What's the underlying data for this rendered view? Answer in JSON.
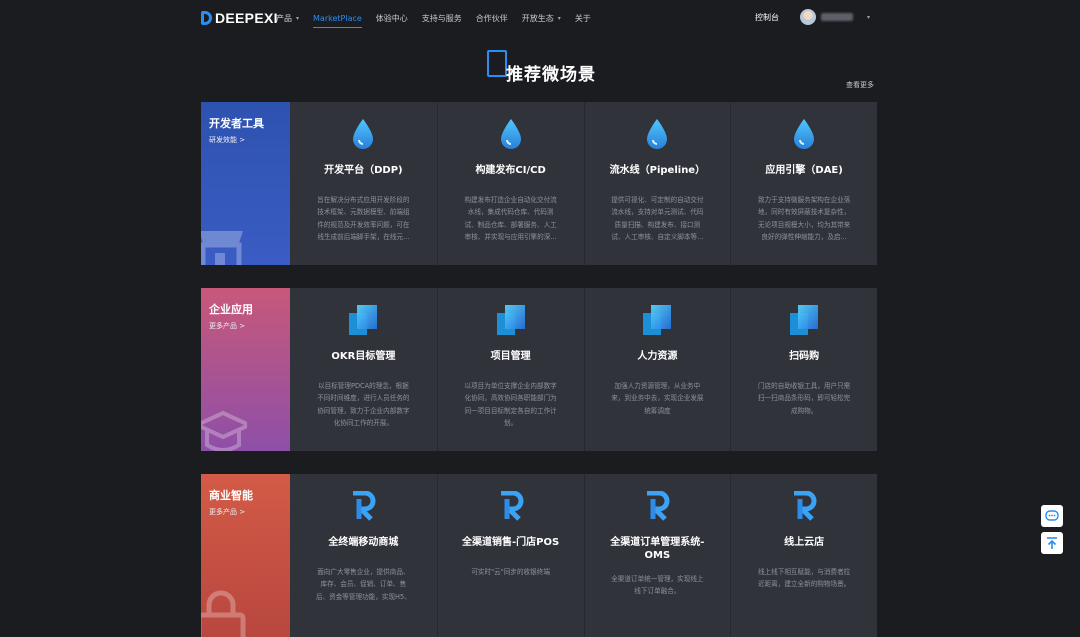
{
  "brand": {
    "name": "DEEPEXI"
  },
  "nav": [
    {
      "label": "产品",
      "has_dropdown": true
    },
    {
      "label": "MarketPlace",
      "active": true
    },
    {
      "label": "体验中心"
    },
    {
      "label": "支持与服务"
    },
    {
      "label": "合作伙伴"
    },
    {
      "label": "开放生态",
      "has_dropdown": true
    },
    {
      "label": "关于"
    }
  ],
  "header_right": {
    "console_label": "控制台",
    "caret": "▾"
  },
  "main": {
    "title": "推荐微场景",
    "see_more": "查看更多"
  },
  "colors": {
    "accent": "#2d8cf0",
    "dev_tools": "#3154b5",
    "enterprise_apps": "#a8558e",
    "business_intel": "#c95a44"
  },
  "sections": [
    {
      "name": "开发者工具",
      "link": "研发效能 >",
      "deco_icon": "storefront-icon",
      "card_icon": "droplet-icon",
      "cards": [
        {
          "title": "开发平台（DDP)",
          "desc": [
            "旨在解决分布式应用开发阶段的",
            "技术框架、元数据模型、前端组",
            "件的规范及开发效率问题，可在",
            "线生成前后端脚手架，在线元..."
          ]
        },
        {
          "title": "构建发布CI/CD",
          "desc": [
            "构建发布打造企业自动化交付流",
            "水线，集成代码仓库、代码测",
            "试、制品仓库、部署服务、人工",
            "审核、并实现与应用引擎的深..."
          ]
        },
        {
          "title": "流水线（Pipeline）",
          "desc": [
            "提供可视化、可定制的自动交付",
            "流水线，支持对单元测试、代码",
            "质量扫描、构建发布、接口测",
            "试、人工审核、自定义脚本等..."
          ]
        },
        {
          "title": "应用引擎（DAE)",
          "desc": [
            "致力于支持微服务架构在企业落",
            "地，同时有效屏蔽技术复杂性，",
            "无论项目规模大小，均为其带来",
            "良好的弹性伸缩能力，及启..."
          ]
        }
      ]
    },
    {
      "name": "企业应用",
      "link": "更多产品 >",
      "deco_icon": "graduation-cap-icon",
      "card_icon": "layered-squares-icon",
      "cards": [
        {
          "title": "OKR目标管理",
          "desc": [
            "以目标管理PDCA的理念，根据",
            "不同时间维度，进行人员任务的",
            "协同管理，致力于企业内部数字",
            "化协同工作的开展。"
          ]
        },
        {
          "title": "项目管理",
          "desc": [
            "以项目为单位支撑企业内部数字",
            "化协同，高效协同各职能部门为",
            "同一项目目标制定各自的工作计",
            "划。"
          ]
        },
        {
          "title": "人力资源",
          "desc": [
            "加强人力资源管理，从业务中",
            "来，到业务中去，实现企业发展",
            "统筹调度"
          ]
        },
        {
          "title": "扫码购",
          "desc": [
            "门店的自助收银工具，用户只需",
            "扫一扫商品条形码，即可轻松完",
            "成购物。"
          ]
        }
      ]
    },
    {
      "name": "商业智能",
      "link": "更多产品 >",
      "deco_icon": "shopping-bag-icon",
      "card_icon": "r-logo-icon",
      "cards": [
        {
          "title": "全终端移动商城",
          "desc": [
            "面向广大零售企业，提供商品、",
            "库存、会员、促销、订单、售",
            "后、资金等管理功能，实现H5、"
          ]
        },
        {
          "title": "全渠道销售-门店POS",
          "desc": [
            "可实时\"云\"同步的收银终端"
          ]
        },
        {
          "title": "全渠道订单管理系统-OMS",
          "two_line": true,
          "desc": [
            "全渠道订单统一管理，实现线上",
            "线下订单融合。"
          ]
        },
        {
          "title": "线上云店",
          "desc": [
            "线上线下相互赋能，与消费者拉",
            "近距离，建立全新的购物场景。"
          ]
        }
      ]
    }
  ],
  "floating": [
    {
      "name": "chat-icon"
    },
    {
      "name": "back-to-top-icon"
    }
  ]
}
